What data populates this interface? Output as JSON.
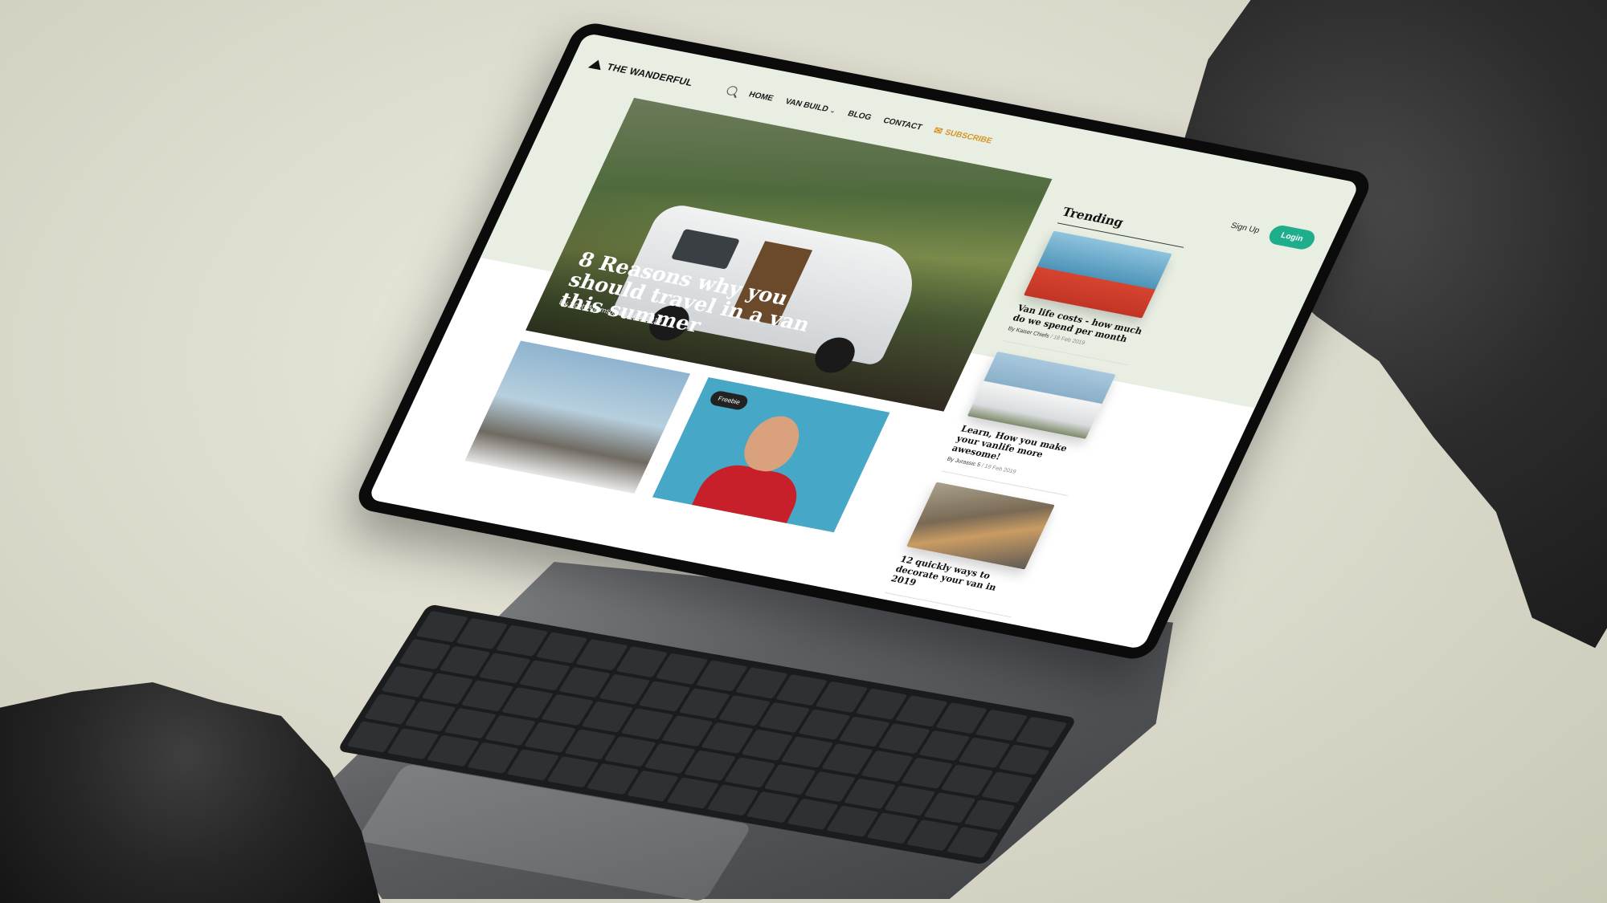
{
  "site": {
    "logo_text": "THE WANDERFUL"
  },
  "nav": {
    "items": [
      {
        "label": "HOME"
      },
      {
        "label": "VAN BUILD"
      },
      {
        "label": "BLOG"
      },
      {
        "label": "CONTACT"
      }
    ],
    "subscribe_label": "SUBSCRIBE"
  },
  "auth": {
    "signup_label": "Sign Up",
    "login_label": "Login"
  },
  "hero": {
    "title": "8 Reasons why you should travel in a van this summer",
    "byline": "By Scott Adamson / 18 Apr 2019"
  },
  "trending": {
    "heading": "Trending",
    "items": [
      {
        "title": "Van life costs - how much do we spend per month",
        "author": "By Kaiser Chiefs",
        "date": "/ 18 Feb 2019"
      },
      {
        "title": "Learn, How you make your vanlife more awesome!",
        "author": "By Jurassic 5",
        "date": "/ 19 Feb 2019"
      },
      {
        "title": "12 quickly ways to decorate your van in 2019",
        "author": "",
        "date": ""
      }
    ]
  },
  "cards": {
    "freebie_badge": "Freebie"
  },
  "colors": {
    "accent": "#1fae8b",
    "subscribe": "#d69324",
    "header_tint": "#e8efe2"
  }
}
